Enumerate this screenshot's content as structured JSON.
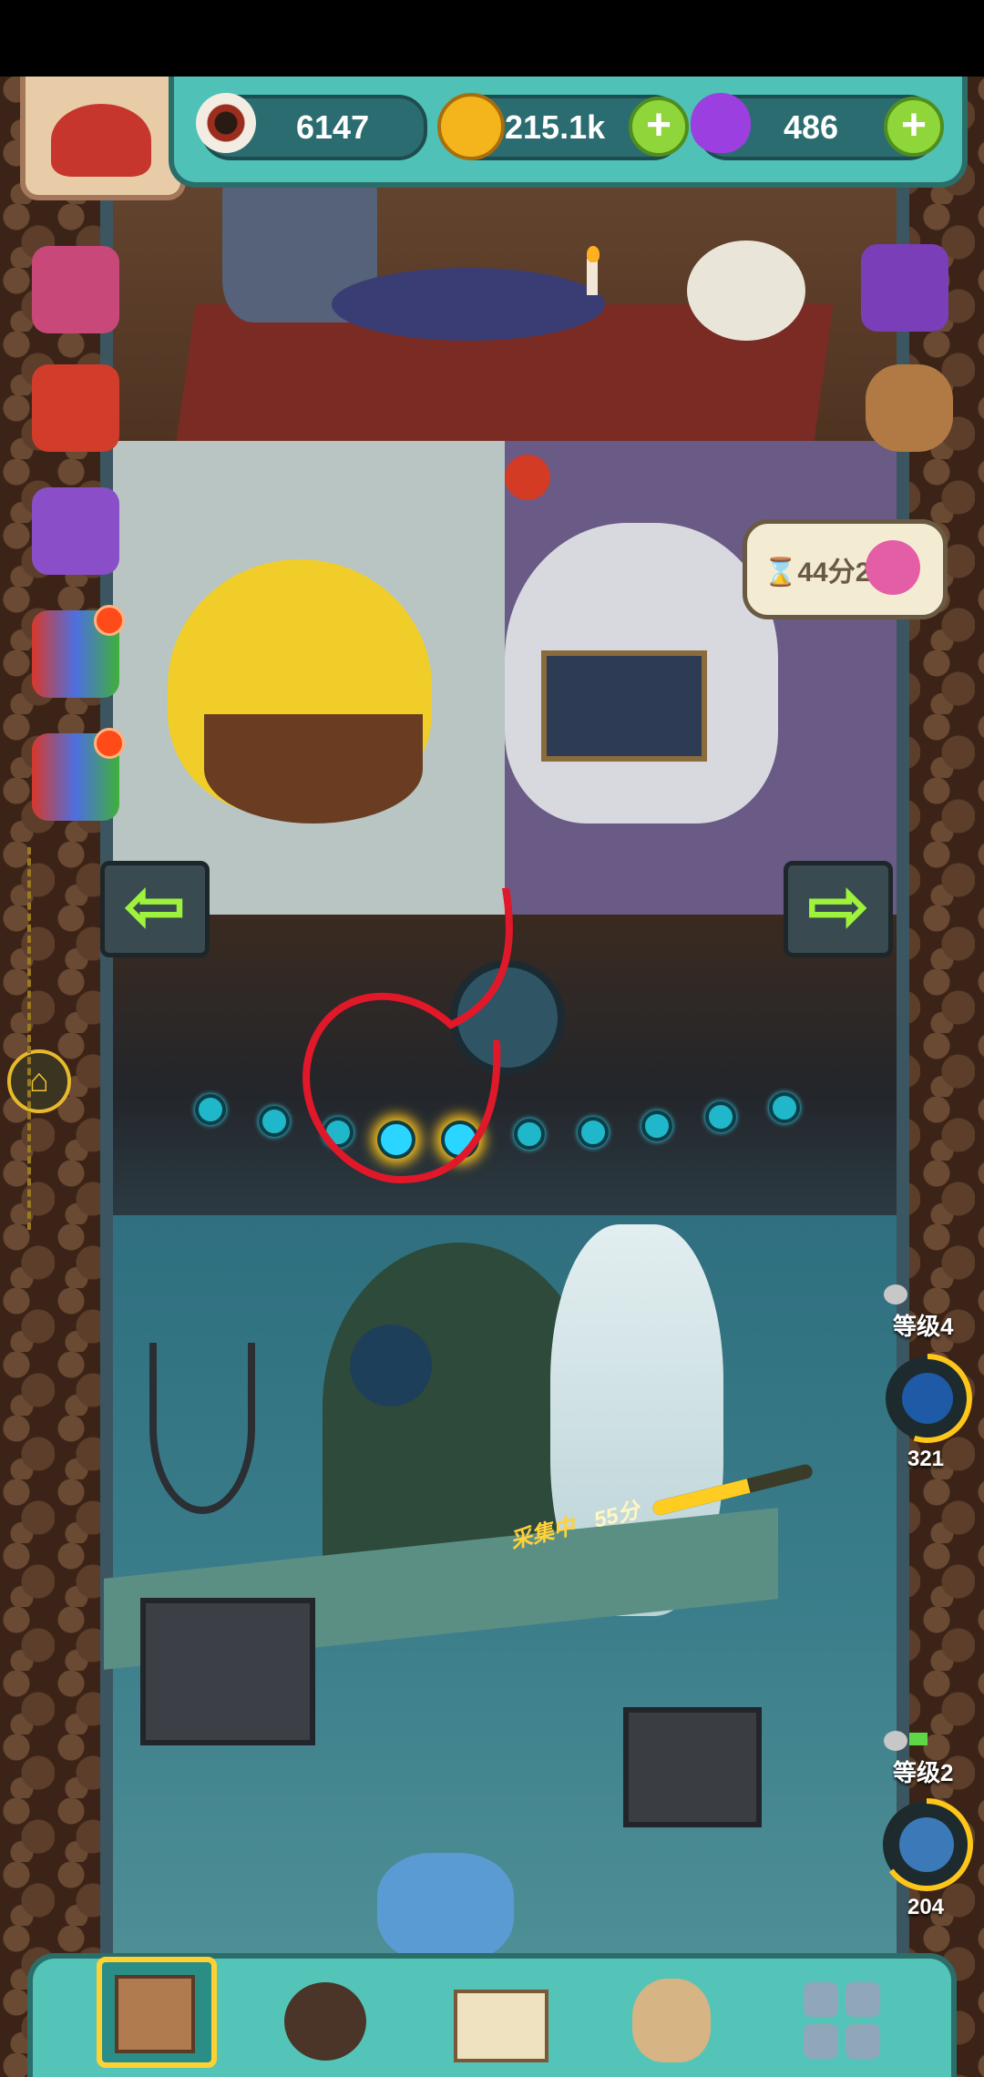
{
  "hud": {
    "eyes": "6147",
    "coins": "215.1k",
    "potions": "486",
    "plus_symbol": "+"
  },
  "bubble": {
    "timer": "⌛44分2"
  },
  "deck": {
    "left_arrow": "⇦",
    "right_arrow": "⇨"
  },
  "collect": {
    "label": "采集中",
    "time": "55分",
    "progress": 0.6
  },
  "levels": [
    {
      "label": "等级4",
      "value": "321",
      "progress": 0.55
    },
    {
      "label": "等级2",
      "value": "204",
      "progress": 0.65
    }
  ],
  "home_icon": "home-icon",
  "colors": {
    "hud_teal": "#4fc1b6",
    "plus_green": "#8ed63a",
    "ring_yellow": "#ffc61a",
    "annotation_red": "#e0182a"
  }
}
